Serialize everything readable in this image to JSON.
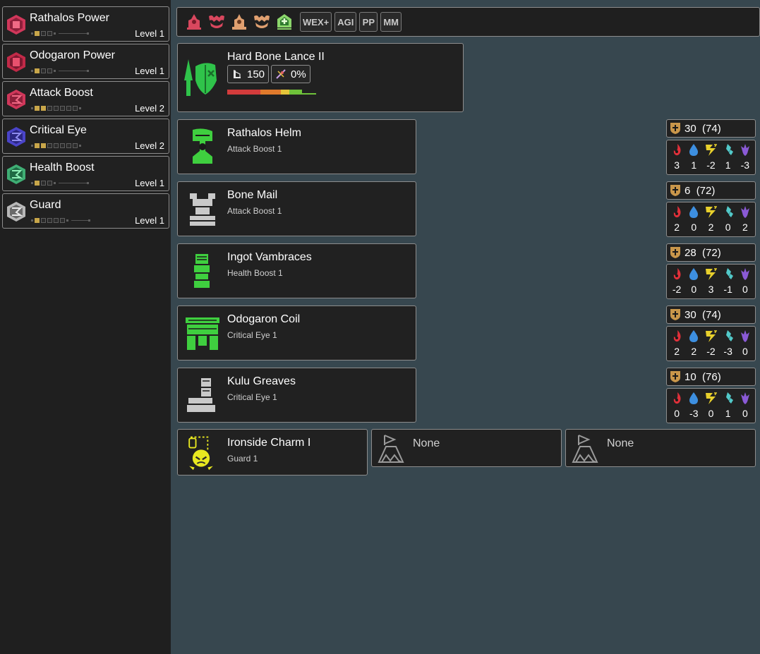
{
  "skills": [
    {
      "name": "Rathalos Power",
      "level": "Level 1",
      "filled": 1,
      "max": 3,
      "color": "#d0375a"
    },
    {
      "name": "Odogaron Power",
      "level": "Level 1",
      "filled": 1,
      "max": 3,
      "color": "#c22a48"
    },
    {
      "name": "Attack Boost",
      "level": "Level 2",
      "filled": 2,
      "max": 7,
      "color": "#d0375a"
    },
    {
      "name": "Critical Eye",
      "level": "Level 2",
      "filled": 2,
      "max": 7,
      "color": "#4a44c9"
    },
    {
      "name": "Health Boost",
      "level": "Level 1",
      "filled": 1,
      "max": 3,
      "color": "#3fae74"
    },
    {
      "name": "Guard",
      "level": "Level 1",
      "filled": 1,
      "max": 5,
      "color": "#b8b8b8"
    }
  ],
  "toolbar": {
    "icons": [
      "rathalos-set-icon",
      "odogaron-set-icon",
      "bone-set-icon",
      "kulu-set-icon",
      "healing-icon"
    ],
    "buttons": [
      "WEX+",
      "AGI",
      "PP",
      "MM"
    ]
  },
  "weapon": {
    "name": "Hard Bone Lance II",
    "attack": "150",
    "affinity": "0%",
    "sharpness": [
      {
        "color": "#d33c3c",
        "fraction": 0.36
      },
      {
        "color": "#e07a2c",
        "fraction": 0.22
      },
      {
        "color": "#e4c43a",
        "fraction": 0.09
      },
      {
        "color": "#6fc23a",
        "fraction": 0.14
      }
    ]
  },
  "armor": [
    {
      "name": "Rathalos Helm",
      "skill": "Attack Boost 1",
      "defense": "30",
      "max_defense": "(74)",
      "res": [
        "3",
        "1",
        "-2",
        "1",
        "-3"
      ],
      "color": "#3fcf3f"
    },
    {
      "name": "Bone Mail",
      "skill": "Attack Boost 1",
      "defense": "6",
      "max_defense": "(72)",
      "res": [
        "2",
        "0",
        "2",
        "0",
        "2"
      ],
      "color": "#c9c9c9"
    },
    {
      "name": "Ingot Vambraces",
      "skill": "Health Boost 1",
      "defense": "28",
      "max_defense": "(72)",
      "res": [
        "-2",
        "0",
        "3",
        "-1",
        "0"
      ],
      "color": "#3fcf3f"
    },
    {
      "name": "Odogaron Coil",
      "skill": "Critical Eye 1",
      "defense": "30",
      "max_defense": "(74)",
      "res": [
        "2",
        "2",
        "-2",
        "-3",
        "0"
      ],
      "color": "#3fcf3f"
    },
    {
      "name": "Kulu Greaves",
      "skill": "Critical Eye 1",
      "defense": "10",
      "max_defense": "(76)",
      "res": [
        "0",
        "-3",
        "0",
        "1",
        "0"
      ],
      "color": "#c9c9c9"
    }
  ],
  "charm": {
    "name": "Ironside Charm I",
    "skill": "Guard 1"
  },
  "tool_slots": [
    "None",
    "None"
  ],
  "colors": {
    "fire": "#e0303a",
    "water": "#3d8fe0",
    "thunder": "#e8d02c",
    "ice": "#52c9c9",
    "dragon": "#8a5ad6",
    "defense": "#c9964a"
  }
}
